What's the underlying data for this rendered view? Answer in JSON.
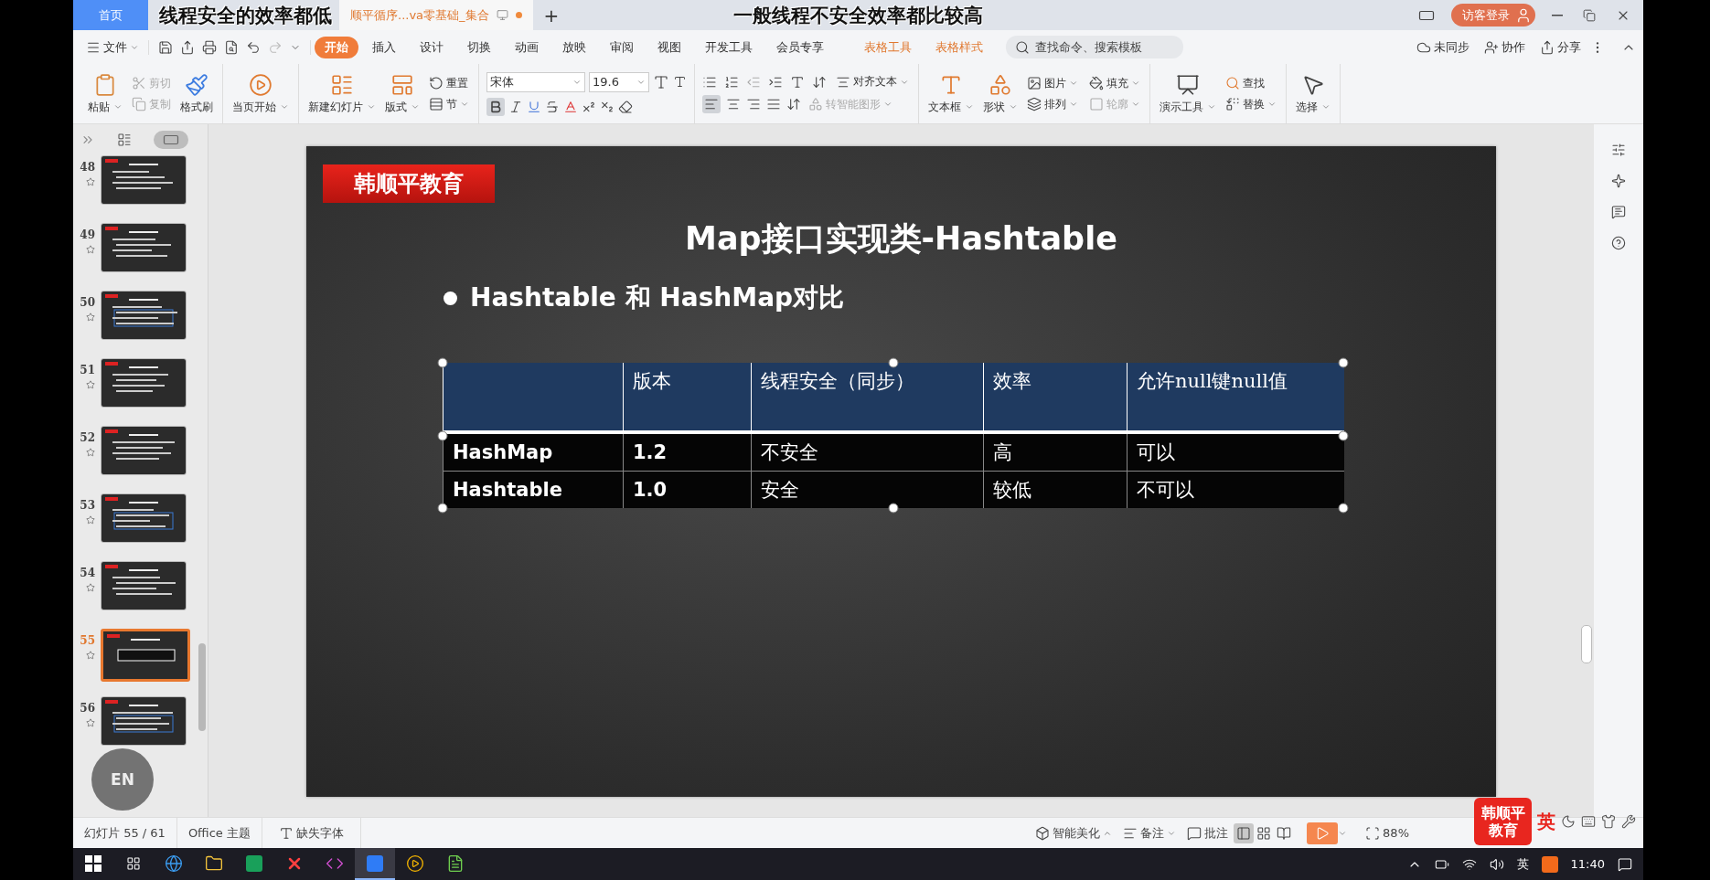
{
  "tab_bar": {
    "tabs": [
      {
        "label": "首页",
        "selected": false,
        "modified": false
      },
      {
        "label": "顺平循序...va零基础_集合",
        "selected": true,
        "modified": true
      }
    ],
    "new_tab": "+",
    "subtitle_left": "线程安全的效率都低",
    "subtitle_center": "一般线程不安全效率都比较高",
    "login": "访客登录"
  },
  "menu_bar": {
    "file": "文件",
    "tabs": [
      {
        "label": "开始",
        "selected": true,
        "kind": "normal"
      },
      {
        "label": "插入",
        "selected": false,
        "kind": "normal"
      },
      {
        "label": "设计",
        "selected": false,
        "kind": "normal"
      },
      {
        "label": "切换",
        "selected": false,
        "kind": "normal"
      },
      {
        "label": "动画",
        "selected": false,
        "kind": "normal"
      },
      {
        "label": "放映",
        "selected": false,
        "kind": "normal"
      },
      {
        "label": "审阅",
        "selected": false,
        "kind": "normal"
      },
      {
        "label": "视图",
        "selected": false,
        "kind": "normal"
      },
      {
        "label": "开发工具",
        "selected": false,
        "kind": "normal"
      },
      {
        "label": "会员专享",
        "selected": false,
        "kind": "normal"
      },
      {
        "label": "表格工具",
        "selected": false,
        "kind": "context"
      },
      {
        "label": "表格样式",
        "selected": false,
        "kind": "context"
      }
    ],
    "search": {
      "placeholder": "查找命令、搜索模板"
    },
    "sync": "未同步",
    "collaborate": "协作",
    "share": "分享"
  },
  "ribbon": {
    "paste": "粘贴",
    "cut": {
      "label": "剪切",
      "disabled": true
    },
    "copy": {
      "label": "复制",
      "disabled": true
    },
    "format_painter": "格式刷",
    "play_current": "当页开始",
    "new_slide": "新建幻灯片",
    "layout": "版式",
    "reset": "重置",
    "section": "节",
    "font": "宋体",
    "font_size": "19.6",
    "bold": {
      "on": true
    },
    "align_left": {
      "on": true
    },
    "align_text": "对齐文本",
    "smart_art": {
      "label": "转智能图形",
      "disabled": true
    },
    "text_box": "文本框",
    "shape": "形状",
    "picture": "图片",
    "fill": "填充",
    "arrange": "排列",
    "outline": {
      "label": "轮廓",
      "disabled": true
    },
    "presenter_tools": "演示工具",
    "find": "查找",
    "replace": "替换",
    "select": "选择"
  },
  "slides_panel": {
    "slides": [
      {
        "number": "48",
        "selected": false
      },
      {
        "number": "49",
        "selected": false
      },
      {
        "number": "50",
        "selected": false
      },
      {
        "number": "51",
        "selected": false
      },
      {
        "number": "52",
        "selected": false
      },
      {
        "number": "53",
        "selected": false
      },
      {
        "number": "54",
        "selected": false
      },
      {
        "number": "55",
        "selected": true
      },
      {
        "number": "56",
        "selected": false
      }
    ],
    "thumbnail_view": true,
    "floating_button": "EN"
  },
  "slide": {
    "logo": "韩顺平教育",
    "title": "Map接口实现类-Hashtable",
    "bullet": "Hashtable 和 HashMap对比",
    "table": {
      "columns": [
        "",
        "版本",
        "线程安全（同步）",
        "效率",
        "允许null键null值"
      ],
      "rows": [
        [
          "HashMap",
          "1.2",
          "不安全",
          "高",
          "可以"
        ],
        [
          "Hashtable",
          "1.0",
          "安全",
          "较低",
          "不可以"
        ]
      ]
    }
  },
  "status_bar": {
    "slide_count": "幻灯片 55 / 61",
    "theme": "Office 主题",
    "missing_fonts": "缺失字体",
    "beautify": "智能美化",
    "notes": "备注",
    "comments": "批注",
    "views": [
      {
        "selected": true
      },
      {
        "selected": false
      },
      {
        "selected": false
      }
    ],
    "zoom": "88%"
  },
  "overlay": {
    "logo_top": "韩顺平",
    "logo_bottom": "教育",
    "ime": "英"
  },
  "taskbar": {
    "apps": [
      {
        "selected": false
      },
      {
        "selected": false
      },
      {
        "selected": false
      },
      {
        "selected": false
      },
      {
        "selected": false
      },
      {
        "selected": true
      },
      {
        "selected": false
      },
      {
        "selected": false
      }
    ],
    "ime": "英",
    "clock": "11:40"
  }
}
